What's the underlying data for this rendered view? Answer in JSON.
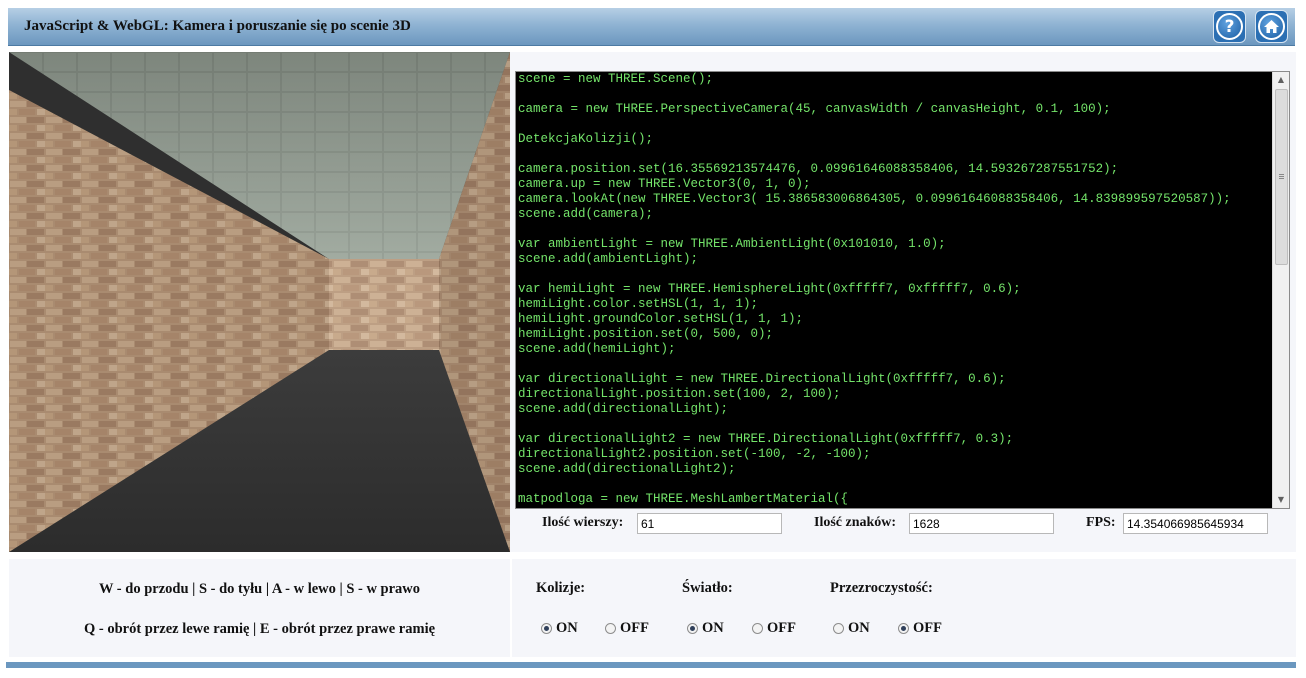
{
  "header": {
    "title": "JavaScript & WebGL: Kamera i poruszanie się po scenie 3D",
    "help_icon": "?",
    "home_icon": "house"
  },
  "code_lines": [
    "scene = new THREE.Scene();",
    "",
    "camera = new THREE.PerspectiveCamera(45, canvasWidth / canvasHeight, 0.1, 100);",
    "",
    "DetekcjaKolizji();",
    "",
    "camera.position.set(16.35569213574476, 0.09961646088358406, 14.593267287551752);",
    "camera.up = new THREE.Vector3(0, 1, 0);",
    "camera.lookAt(new THREE.Vector3( 15.386583006864305, 0.09961646088358406, 14.839899597520587));",
    "scene.add(camera);",
    "",
    "var ambientLight = new THREE.AmbientLight(0x101010, 1.0);",
    "scene.add(ambientLight);",
    "",
    "var hemiLight = new THREE.HemisphereLight(0xfffff7, 0xfffff7, 0.6);",
    "hemiLight.color.setHSL(1, 1, 1);",
    "hemiLight.groundColor.setHSL(1, 1, 1);",
    "hemiLight.position.set(0, 500, 0);",
    "scene.add(hemiLight);",
    "",
    "var directionalLight = new THREE.DirectionalLight(0xfffff7, 0.6);",
    "directionalLight.position.set(100, 2, 100);",
    "scene.add(directionalLight);",
    "",
    "var directionalLight2 = new THREE.DirectionalLight(0xfffff7, 0.3);",
    "directionalLight2.position.set(-100, -2, -100);",
    "scene.add(directionalLight2);",
    "",
    "matpodloga = new THREE.MeshLambertMaterial({"
  ],
  "stats": {
    "rows_label": "Ilość wierszy:",
    "rows_value": "61",
    "chars_label": "Ilość znaków:",
    "chars_value": "1628",
    "fps_label": "FPS:",
    "fps_value": "14.354066985645934"
  },
  "instructions": {
    "line1": "W - do przodu | S - do tyłu | A - w lewo | S - w prawo",
    "line2": "Q - obrót przez lewe ramię | E - obrót przez prawe ramię"
  },
  "options": {
    "collisions": {
      "label": "Kolizje:",
      "on": "ON",
      "off": "OFF",
      "selected": "ON"
    },
    "light": {
      "label": "Światło:",
      "on": "ON",
      "off": "OFF",
      "selected": "ON"
    },
    "transparency": {
      "label": "Przezroczystość:",
      "on": "ON",
      "off": "OFF",
      "selected": "OFF"
    }
  },
  "colors": {
    "header": "#8fb3d3",
    "code_text": "#74e46a",
    "code_bg": "#000000",
    "footer": "#6b97bf"
  }
}
